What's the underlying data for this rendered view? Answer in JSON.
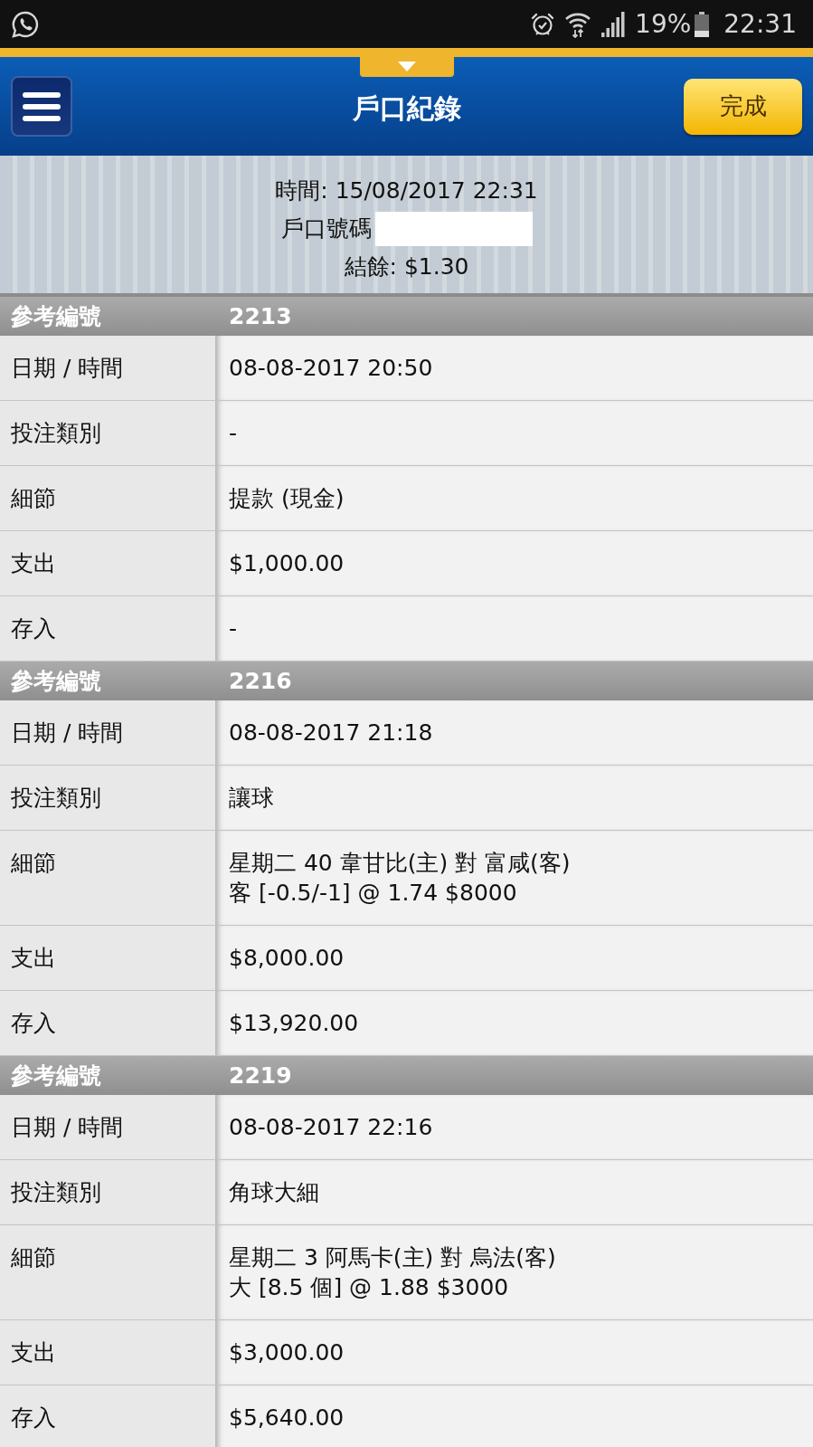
{
  "status_bar": {
    "battery": "19%",
    "time": "22:31"
  },
  "header": {
    "title": "戶口紀錄",
    "done_button": "完成"
  },
  "summary": [
    {
      "kind": "text",
      "text": "時間: 15/08/2017 22:31"
    },
    {
      "kind": "redacted",
      "text": "戶口號碼"
    },
    {
      "kind": "text",
      "text": "結餘: $1.30"
    }
  ],
  "records": [
    {
      "header": {
        "label": "參考編號",
        "value": "2213"
      },
      "fields": [
        {
          "label": "日期 / 時間",
          "value": "08-08-2017 20:50"
        },
        {
          "label": "投注類別",
          "value": "-"
        },
        {
          "label": "細節",
          "value": "提款 (現金)"
        },
        {
          "label": "支出",
          "value": "$1,000.00"
        },
        {
          "label": "存入",
          "value": "-"
        }
      ]
    },
    {
      "header": {
        "label": "參考編號",
        "value": "2216"
      },
      "fields": [
        {
          "label": "日期 / 時間",
          "value": "08-08-2017 21:18"
        },
        {
          "label": "投注類別",
          "value": "讓球"
        },
        {
          "label": "細節",
          "value": "星期二 40 韋甘比(主) 對 富咸(客)\n客 [-0.5/-1] @ 1.74 $8000"
        },
        {
          "label": "支出",
          "value": "$8,000.00"
        },
        {
          "label": "存入",
          "value": "$13,920.00"
        }
      ]
    },
    {
      "header": {
        "label": "參考編號",
        "value": "2219"
      },
      "fields": [
        {
          "label": "日期 / 時間",
          "value": "08-08-2017 22:16"
        },
        {
          "label": "投注類別",
          "value": "角球大細"
        },
        {
          "label": "細節",
          "value": "星期二 3 阿馬卡(主) 對 烏法(客)\n大 [8.5 個] @ 1.88 $3000"
        },
        {
          "label": "支出",
          "value": "$3,000.00"
        },
        {
          "label": "存入",
          "value": "$5,640.00"
        }
      ]
    }
  ]
}
